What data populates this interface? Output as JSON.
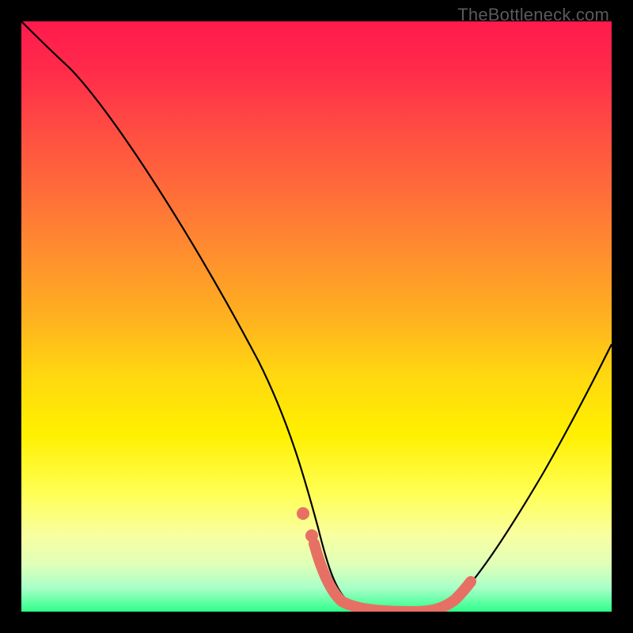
{
  "watermark": {
    "text": "TheBottleneck.com"
  },
  "chart_data": {
    "type": "line",
    "title": "",
    "xlabel": "",
    "ylabel": "",
    "xlim": [
      0,
      100
    ],
    "ylim": [
      0,
      100
    ],
    "grid": false,
    "series": [
      {
        "name": "primary-curve",
        "x": [
          0,
          4,
          10,
          20,
          30,
          40,
          45,
          49,
          51,
          54,
          58,
          62,
          67,
          70,
          74,
          80,
          88,
          95,
          100
        ],
        "values": [
          100,
          97,
          92,
          78,
          61,
          42,
          31,
          16,
          8,
          3,
          1,
          0,
          0,
          1,
          3,
          10,
          24,
          38,
          48
        ]
      },
      {
        "name": "highlight-segment",
        "x": [
          49,
          51,
          53,
          55,
          58,
          61,
          64,
          67,
          70,
          73
        ],
        "values": [
          12,
          7,
          4,
          2,
          1,
          0,
          0,
          0,
          1,
          3
        ]
      },
      {
        "name": "highlight-dot-1",
        "x": [
          47.5
        ],
        "values": [
          17
        ]
      },
      {
        "name": "highlight-dot-2",
        "x": [
          49
        ],
        "values": [
          12
        ]
      }
    ],
    "colors": {
      "primary_curve": "#000000",
      "highlight": "#e77065",
      "gradient_top": "#ff1a4d",
      "gradient_bottom": "#2eff8a"
    }
  }
}
